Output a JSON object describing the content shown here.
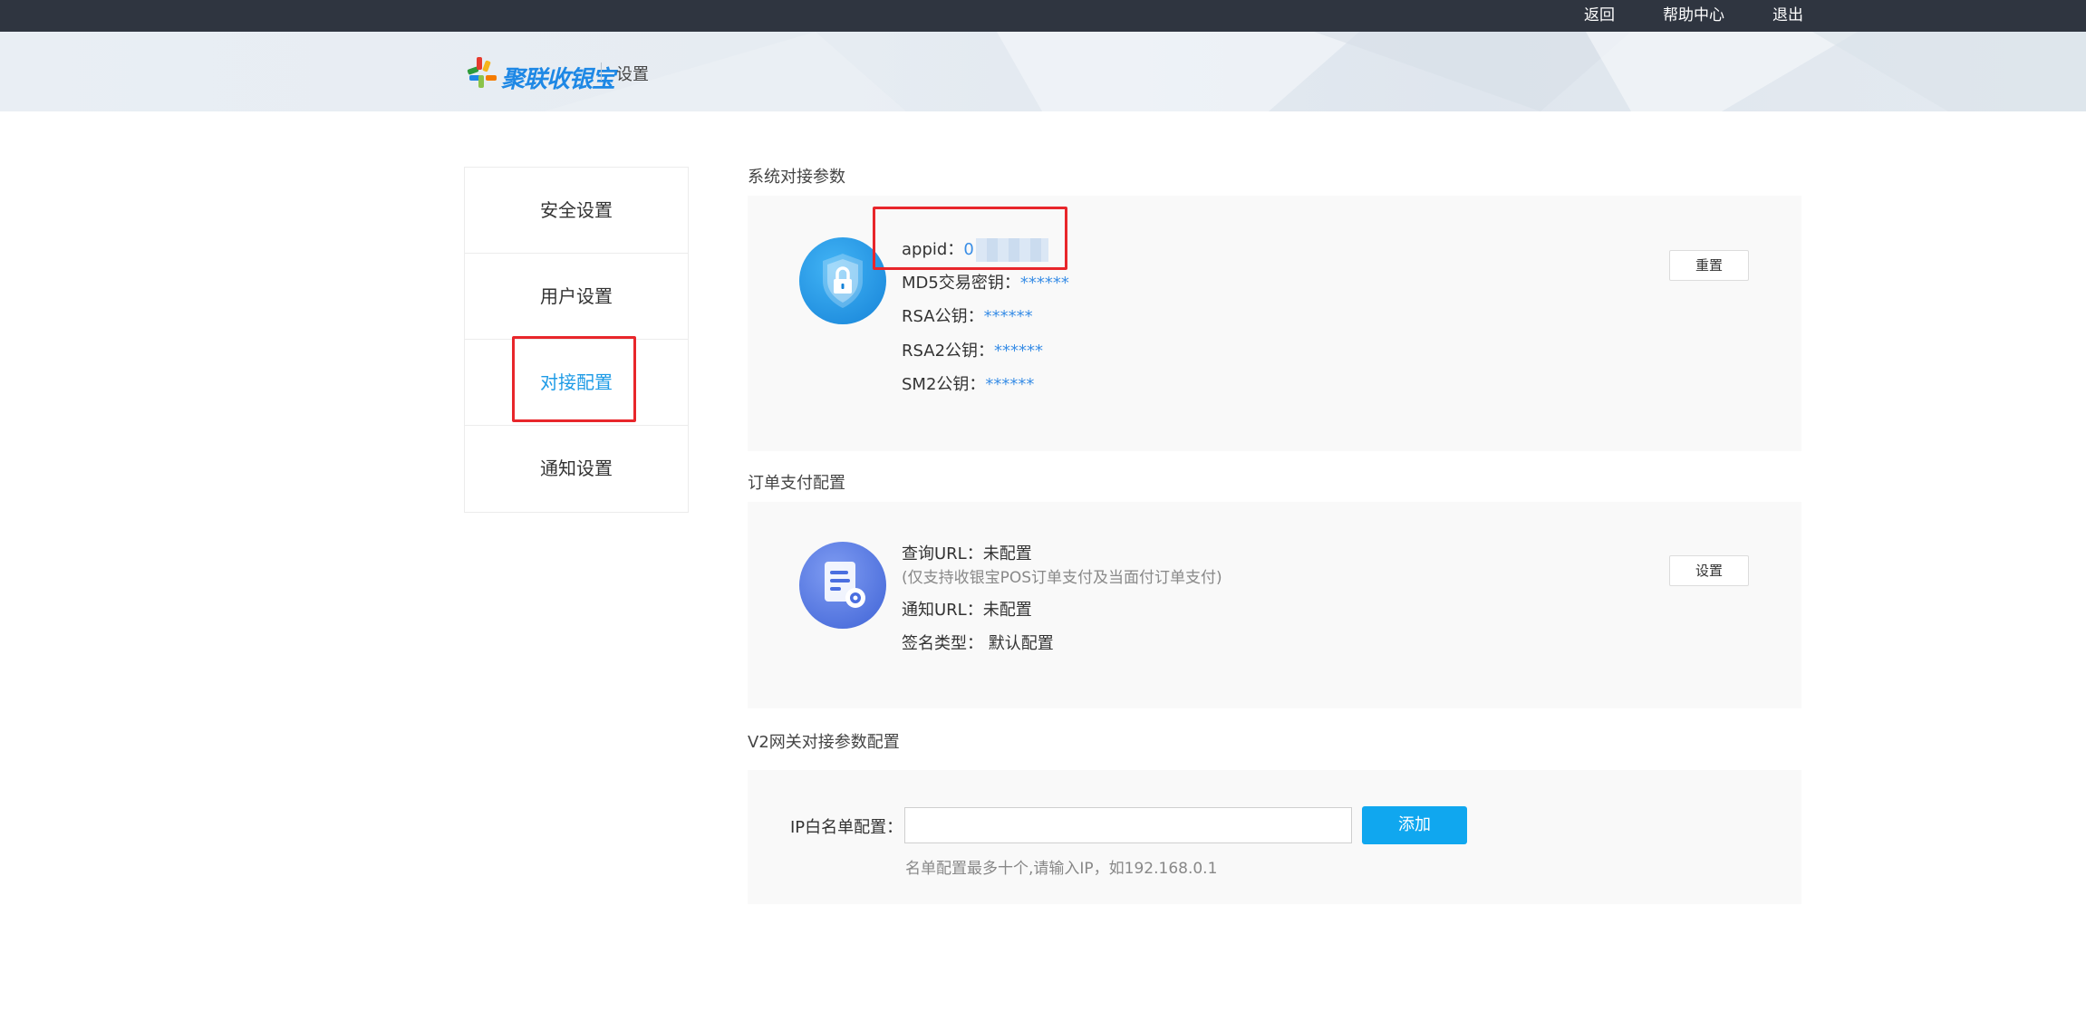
{
  "topbar": {
    "links": [
      "返回",
      "帮助中心",
      "退出"
    ]
  },
  "header": {
    "logo_text": "聚联收银宝",
    "page_title": "设置"
  },
  "sidebar": {
    "items": [
      {
        "label": "安全设置",
        "active": false
      },
      {
        "label": "用户设置",
        "active": false
      },
      {
        "label": "对接配置",
        "active": true
      },
      {
        "label": "通知设置",
        "active": false
      }
    ]
  },
  "system_params": {
    "title": "系统对接参数",
    "appid_label": "appid：",
    "appid_value": "0",
    "md5_label": "MD5交易密钥：",
    "md5_value": "******",
    "rsa_label": "RSA公钥：",
    "rsa_value": "******",
    "rsa2_label": "RSA2公钥：",
    "rsa2_value": "******",
    "sm2_label": "SM2公钥：",
    "sm2_value": "******",
    "reset_button": "重置",
    "icon": "shield-lock-icon"
  },
  "order_config": {
    "title": "订单支付配置",
    "query_url_label": "查询URL：",
    "query_url_value": "未配置",
    "query_url_hint": "(仅支持收银宝POS订单支付及当面付订单支付)",
    "notify_url_label": "通知URL：",
    "notify_url_value": "未配置",
    "sign_type_label": "签名类型：",
    "sign_type_value": "默认配置",
    "settings_button": "设置",
    "icon": "document-gear-icon"
  },
  "v2_gateway": {
    "title": "V2网关对接参数配置",
    "ip_label": "IP白名单配置：",
    "ip_input_value": "",
    "add_button": "添加",
    "hint": "名单配置最多十个,请输入IP，如192.168.0.1"
  },
  "colors": {
    "accent": "#1e9be6",
    "topbar_bg": "#2f3540",
    "highlight_red": "#e8262b",
    "add_button_bg": "#10a7ef"
  }
}
